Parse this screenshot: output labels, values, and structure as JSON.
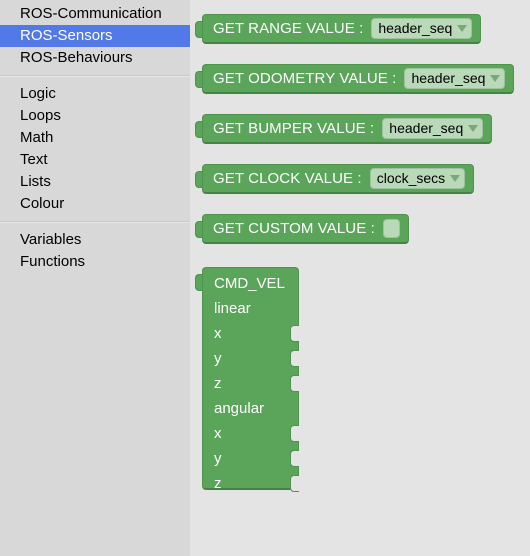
{
  "toolbox": {
    "groups": [
      {
        "items": [
          {
            "label": "ROS-Communication",
            "selected": false
          },
          {
            "label": "ROS-Sensors",
            "selected": true
          },
          {
            "label": "ROS-Behaviours",
            "selected": false
          }
        ]
      },
      {
        "items": [
          {
            "label": "Logic",
            "selected": false
          },
          {
            "label": "Loops",
            "selected": false
          },
          {
            "label": "Math",
            "selected": false
          },
          {
            "label": "Text",
            "selected": false
          },
          {
            "label": "Lists",
            "selected": false
          },
          {
            "label": "Colour",
            "selected": false
          }
        ]
      },
      {
        "items": [
          {
            "label": "Variables",
            "selected": false
          },
          {
            "label": "Functions",
            "selected": false
          }
        ]
      }
    ]
  },
  "workspace": {
    "value_blocks": [
      {
        "label": "GET RANGE VALUE :",
        "field": "header_seq",
        "has_dropdown": true
      },
      {
        "label": "GET ODOMETRY VALUE :",
        "field": "header_seq",
        "has_dropdown": true
      },
      {
        "label": "GET BUMPER VALUE :",
        "field": "header_seq",
        "has_dropdown": true
      },
      {
        "label": "GET CLOCK VALUE :",
        "field": "clock_secs",
        "has_dropdown": true
      },
      {
        "label": "GET CUSTOM VALUE :",
        "field": "",
        "has_dropdown": false
      }
    ],
    "cmd_vel_block": {
      "title": "CMD_VEL",
      "rows": [
        {
          "label": "CMD_VEL",
          "socket": false
        },
        {
          "label": "linear",
          "socket": false
        },
        {
          "label": "x",
          "socket": true
        },
        {
          "label": "y",
          "socket": true
        },
        {
          "label": "z",
          "socket": true
        },
        {
          "label": "angular",
          "socket": false
        },
        {
          "label": "x",
          "socket": true
        },
        {
          "label": "y",
          "socket": true
        },
        {
          "label": "z",
          "socket": true
        }
      ]
    }
  },
  "colors": {
    "block_green": "#5ba55b",
    "field_green": "#b9d9b9",
    "selection_blue": "#5179e8",
    "toolbox_bg": "#d8d8d8",
    "workspace_bg": "#e4e4e4"
  }
}
